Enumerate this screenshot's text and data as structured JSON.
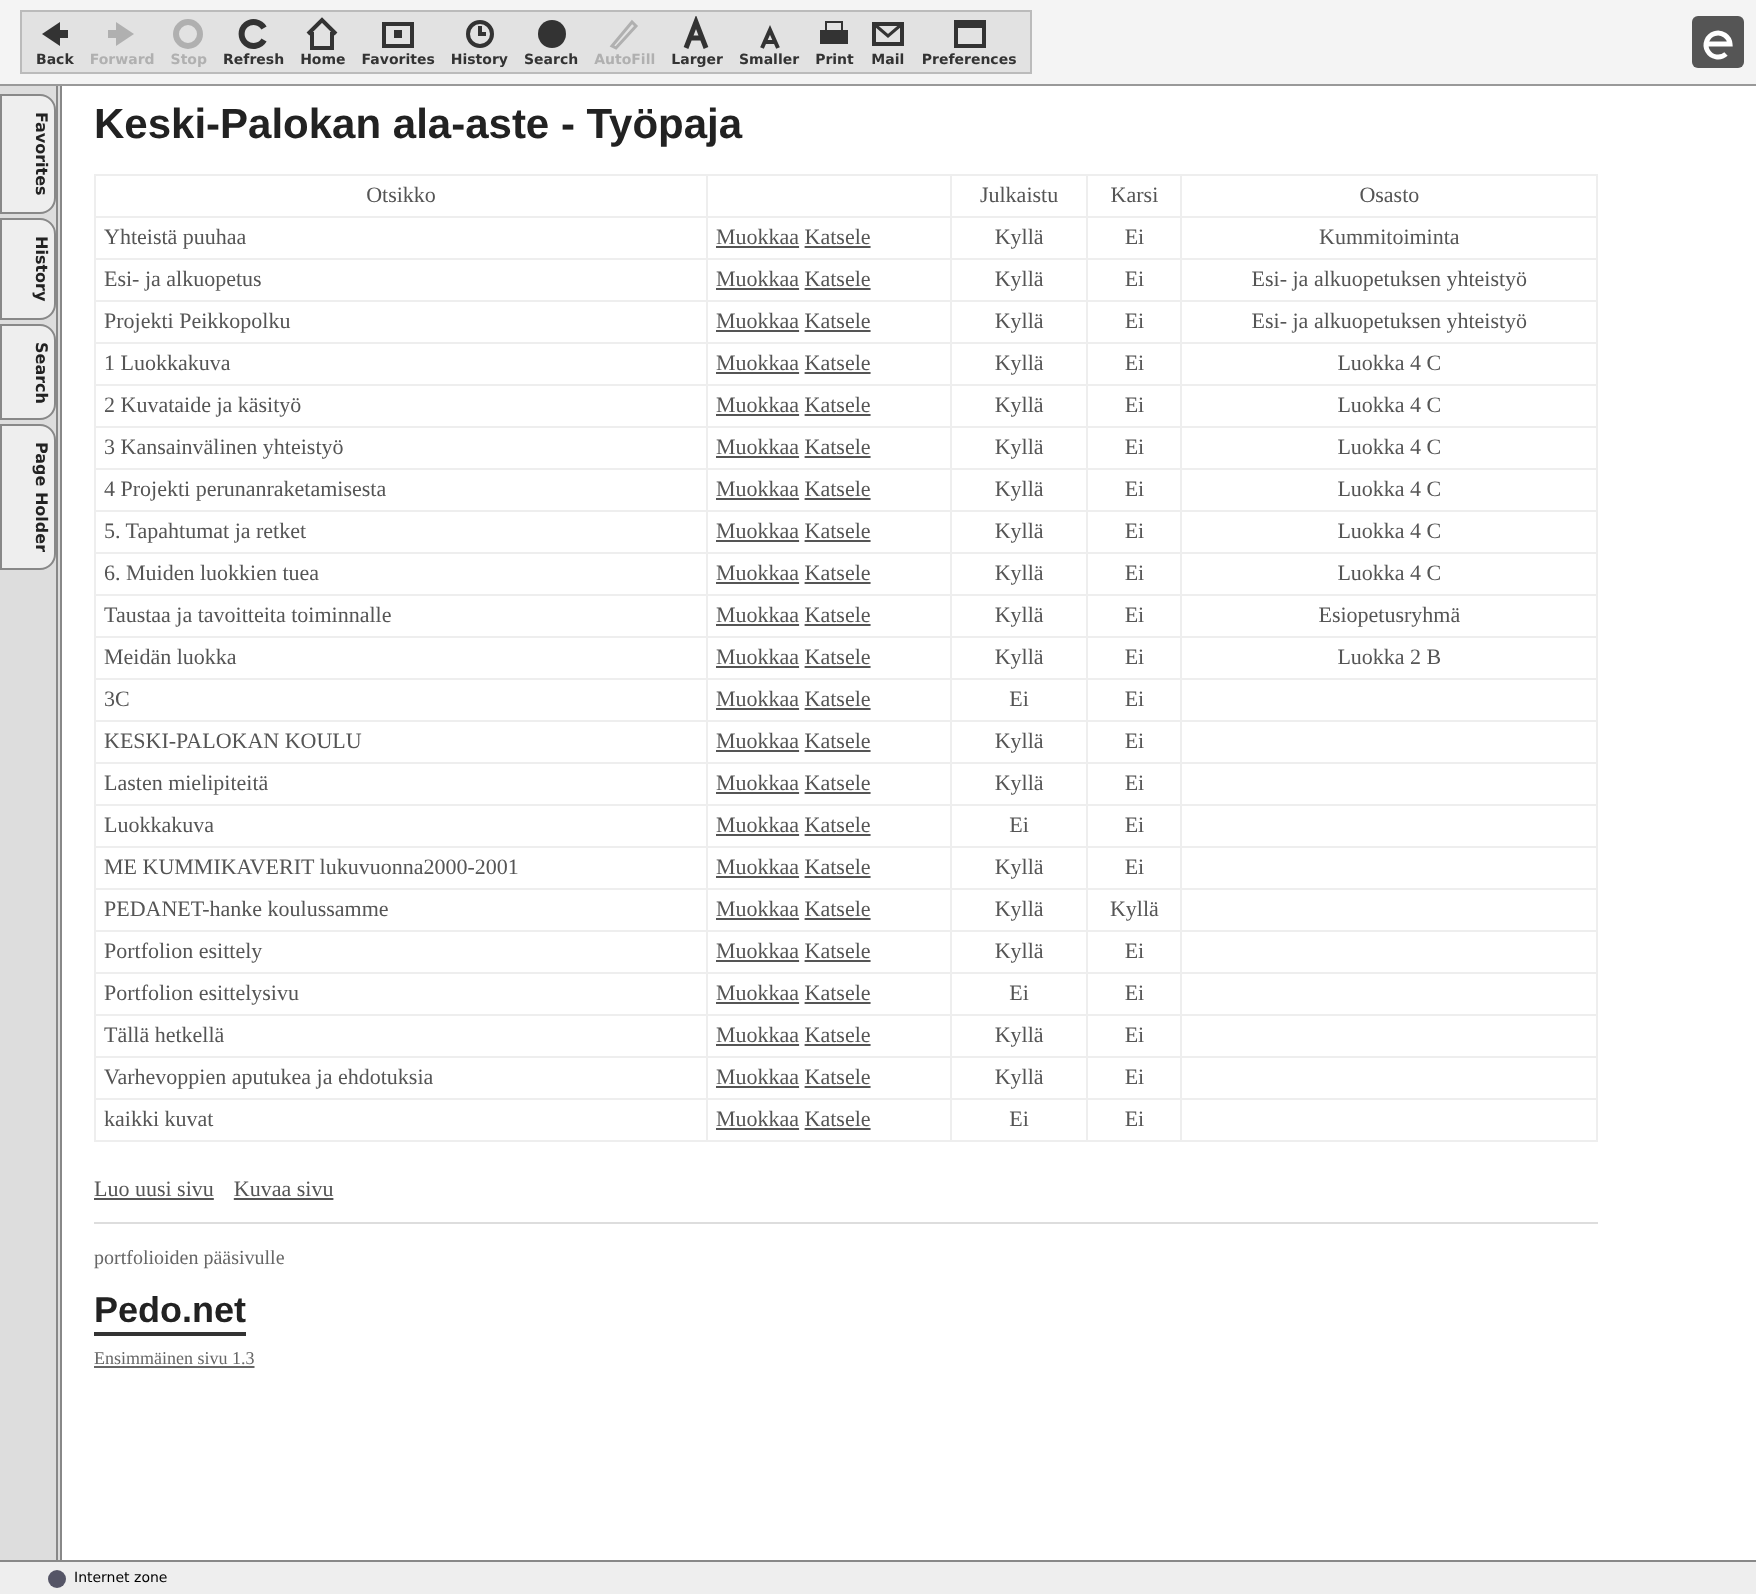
{
  "toolbar": {
    "buttons": [
      {
        "label": "Back",
        "disabled": false
      },
      {
        "label": "Forward",
        "disabled": true
      },
      {
        "label": "Stop",
        "disabled": true
      },
      {
        "label": "Refresh",
        "disabled": false
      },
      {
        "label": "Home",
        "disabled": false
      },
      {
        "label": "Favorites",
        "disabled": false
      },
      {
        "label": "History",
        "disabled": false
      },
      {
        "label": "Search",
        "disabled": false
      },
      {
        "label": "AutoFill",
        "disabled": true
      },
      {
        "label": "Larger",
        "disabled": false
      },
      {
        "label": "Smaller",
        "disabled": false
      },
      {
        "label": "Print",
        "disabled": false
      },
      {
        "label": "Mail",
        "disabled": false
      },
      {
        "label": "Preferences",
        "disabled": false
      }
    ]
  },
  "side_tabs": [
    "Favorites",
    "History",
    "Search",
    "Page Holder"
  ],
  "page": {
    "title": "Keski-Palokan ala-aste - Työpaja",
    "table": {
      "columns": [
        "Otsikko",
        "Julkaistu",
        "Karsi",
        "Osasto"
      ],
      "rows": [
        {
          "title": "Yhteistä puuhaa",
          "edit": "Muokkaa",
          "view": "Katsele",
          "published": "Kyllä",
          "col3": "Ei",
          "section": "Kummitoiminta"
        },
        {
          "title": "Esi- ja alkuopetus",
          "edit": "Muokkaa",
          "view": "Katsele",
          "published": "Kyllä",
          "col3": "Ei",
          "section": "Esi- ja alkuopetuksen yhteistyö"
        },
        {
          "title": "Projekti Peikkopolku",
          "edit": "Muokkaa",
          "view": "Katsele",
          "published": "Kyllä",
          "col3": "Ei",
          "section": "Esi- ja alkuopetuksen yhteistyö"
        },
        {
          "title": "1 Luokkakuva",
          "edit": "Muokkaa",
          "view": "Katsele",
          "published": "Kyllä",
          "col3": "Ei",
          "section": "Luokka 4 C"
        },
        {
          "title": "2 Kuvataide ja käsityö",
          "edit": "Muokkaa",
          "view": "Katsele",
          "published": "Kyllä",
          "col3": "Ei",
          "section": "Luokka 4 C"
        },
        {
          "title": "3 Kansainvälinen yhteistyö",
          "edit": "Muokkaa",
          "view": "Katsele",
          "published": "Kyllä",
          "col3": "Ei",
          "section": "Luokka 4 C"
        },
        {
          "title": "4 Projekti perunanraketamisesta",
          "edit": "Muokkaa",
          "view": "Katsele",
          "published": "Kyllä",
          "col3": "Ei",
          "section": "Luokka 4 C"
        },
        {
          "title": "5. Tapahtumat ja retket",
          "edit": "Muokkaa",
          "view": "Katsele",
          "published": "Kyllä",
          "col3": "Ei",
          "section": "Luokka 4 C"
        },
        {
          "title": "6. Muiden luokkien tuea",
          "edit": "Muokkaa",
          "view": "Katsele",
          "published": "Kyllä",
          "col3": "Ei",
          "section": "Luokka 4 C"
        },
        {
          "title": "Taustaa ja tavoitteita toiminnalle",
          "edit": "Muokkaa",
          "view": "Katsele",
          "published": "Kyllä",
          "col3": "Ei",
          "section": "Esiopetusryhmä"
        },
        {
          "title": "Meidän luokka",
          "edit": "Muokkaa",
          "view": "Katsele",
          "published": "Kyllä",
          "col3": "Ei",
          "section": "Luokka 2 B"
        },
        {
          "title": "3C",
          "edit": "Muokkaa",
          "view": "Katsele",
          "published": "Ei",
          "col3": "Ei"
        },
        {
          "title": "KESKI-PALOKAN KOULU",
          "edit": "Muokkaa",
          "view": "Katsele",
          "published": "Kyllä",
          "col3": "Ei"
        },
        {
          "title": "Lasten mielipiteitä",
          "edit": "Muokkaa",
          "view": "Katsele",
          "published": "Kyllä",
          "col3": "Ei"
        },
        {
          "title": "Luokkakuva",
          "edit": "Muokkaa",
          "view": "Katsele",
          "published": "Ei",
          "col3": "Ei"
        },
        {
          "title": "ME KUMMIKAVERIT lukuvuonna2000-2001",
          "edit": "Muokkaa",
          "view": "Katsele",
          "published": "Kyllä",
          "col3": "Ei"
        },
        {
          "title": "PEDANET-hanke koulussamme",
          "edit": "Muokkaa",
          "view": "Katsele",
          "published": "Kyllä",
          "col3": "Kyllä"
        },
        {
          "title": "Portfolion esittely",
          "edit": "Muokkaa",
          "view": "Katsele",
          "published": "Kyllä",
          "col3": "Ei"
        },
        {
          "title": "Portfolion esittelysivu",
          "edit": "Muokkaa",
          "view": "Katsele",
          "published": "Ei",
          "col3": "Ei"
        },
        {
          "title": "Tällä hetkellä",
          "edit": "Muokkaa",
          "view": "Katsele",
          "published": "Kyllä",
          "col3": "Ei"
        },
        {
          "title": "Varhevoppien aputukea ja ehdotuksia",
          "edit": "Muokkaa",
          "view": "Katsele",
          "published": "Kyllä",
          "col3": "Ei"
        },
        {
          "title": "kaikki kuvat",
          "edit": "Muokkaa",
          "view": "Katsele",
          "published": "Ei",
          "col3": "Ei"
        }
      ]
    },
    "actions": [
      "Luo uusi sivu",
      "Kuvaa sivu"
    ],
    "back_link": "portfolioiden pääsivulle",
    "logo": "Pedo.net",
    "version_link": "Ensimmäinen sivu 1.3"
  },
  "status_bar": "Internet zone"
}
